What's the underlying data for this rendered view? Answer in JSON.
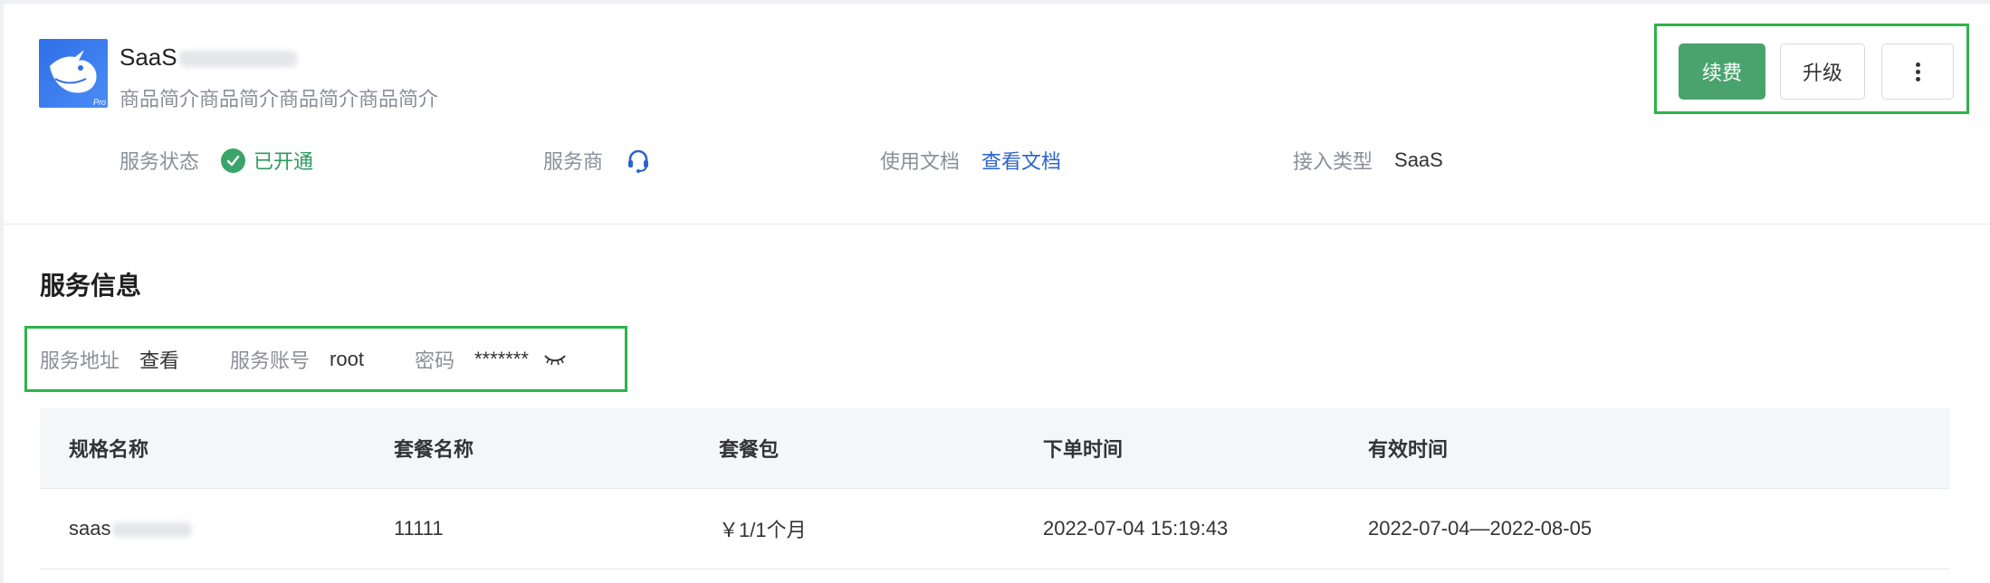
{
  "product": {
    "title_prefix": "SaaS",
    "subtitle": "商品简介商品简介商品简介商品简介",
    "logo_badge": "Pro"
  },
  "info": {
    "status_label": "服务状态",
    "status_value": "已开通",
    "provider_label": "服务商",
    "provider_icon": "headset-icon",
    "docs_label": "使用文档",
    "docs_link": "查看文档",
    "access_label": "接入类型",
    "access_value": "SaaS"
  },
  "actions": {
    "renew": "续费",
    "upgrade": "升级"
  },
  "service": {
    "section_title": "服务信息",
    "address_label": "服务地址",
    "address_link": "查看",
    "account_label": "服务账号",
    "account_value": "root",
    "password_label": "密码",
    "password_value": "*******",
    "password_icon": "eye-closed-icon"
  },
  "table": {
    "headers": [
      "规格名称",
      "套餐名称",
      "套餐包",
      "下单时间",
      "有效时间"
    ],
    "rows": [
      [
        "saas",
        "11111",
        "￥1/1个月",
        "2022-07-04 15:19:43",
        "2022-07-04—2022-08-05"
      ]
    ]
  },
  "colors": {
    "accent_green": "#4aa36d",
    "status_green": "#2e9b5e",
    "link_blue": "#2b63c9",
    "highlight_box": "#2fb34a"
  }
}
